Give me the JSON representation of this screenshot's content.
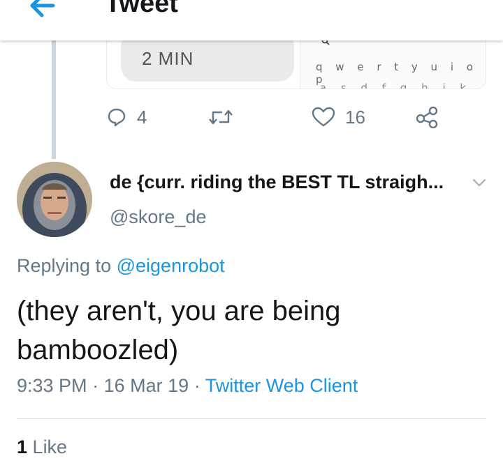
{
  "header": {
    "title": "Tweet",
    "back_icon": "back-arrow-icon",
    "accent": "#1b95e0"
  },
  "quoted_card": {
    "duration_label": "2 MIN",
    "keyboard_row_1": "q w e r t y u i o p",
    "keyboard_row_2": "a s d f g h j k l"
  },
  "parent_actions": {
    "reply_count": "4",
    "like_count": "16",
    "icons": [
      "reply-icon",
      "retweet-icon",
      "like-heart-icon",
      "share-icon"
    ]
  },
  "tweet": {
    "display_name": "de {curr. riding the BEST TL straigh...",
    "handle": "@skore_de",
    "replying_to_label": "Replying to",
    "replying_to_handle": "@eigenrobot",
    "text_line_1": "(they aren't, you are being",
    "text_line_2": "bamboozled)",
    "time": "9:33 PM",
    "separator": "·",
    "date": "16 Mar 19",
    "client": "Twitter Web Client",
    "like_count": "1",
    "like_label": "Like"
  },
  "colors": {
    "link_blue": "#1b95e0",
    "secondary_text": "#657786",
    "thread_line": "#ccd6dd"
  }
}
